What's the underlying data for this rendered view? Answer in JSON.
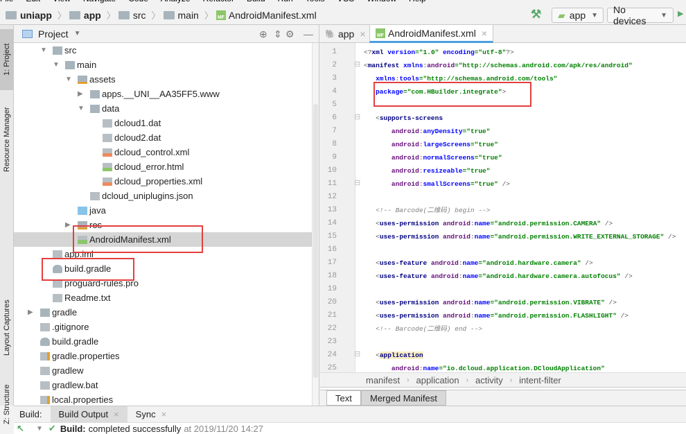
{
  "menubar": [
    "File",
    "Edit",
    "View",
    "Navigate",
    "Code",
    "Analyze",
    "Refactor",
    "Build",
    "Run",
    "Tools",
    "VCS",
    "Window",
    "Help"
  ],
  "breadcrumb": [
    "uniapp",
    "app",
    "src",
    "main",
    "AndroidManifest.xml"
  ],
  "toolbar": {
    "config": "app",
    "device": "No devices"
  },
  "left_strip": {
    "project": "1: Project",
    "resource_manager": "Resource Manager",
    "layout_captures": "Layout Captures",
    "structure": "Z: Structure"
  },
  "project": {
    "title": "Project",
    "tree": [
      {
        "label": "src",
        "level": 1,
        "expand": "open",
        "icon": "folder"
      },
      {
        "label": "main",
        "level": 2,
        "expand": "open",
        "icon": "folder"
      },
      {
        "label": "assets",
        "level": 3,
        "expand": "open",
        "icon": "assets-folder"
      },
      {
        "label": "apps.__UNI__AA35FF5.www",
        "level": 4,
        "expand": "closed",
        "icon": "folder-dot"
      },
      {
        "label": "data",
        "level": 4,
        "expand": "open",
        "icon": "folder-dot"
      },
      {
        "label": "dcloud1.dat",
        "level": 5,
        "icon": "unknown-file"
      },
      {
        "label": "dcloud2.dat",
        "level": 5,
        "icon": "unknown-file"
      },
      {
        "label": "dcloud_control.xml",
        "level": 5,
        "icon": "xml-file"
      },
      {
        "label": "dcloud_error.html",
        "level": 5,
        "icon": "html-file"
      },
      {
        "label": "dcloud_properties.xml",
        "level": 5,
        "icon": "xml-file"
      },
      {
        "label": "dcloud_uniplugins.json",
        "level": 4,
        "icon": "json-file"
      },
      {
        "label": "java",
        "level": 3,
        "icon": "source-folder"
      },
      {
        "label": "res",
        "level": 3,
        "expand": "closed",
        "icon": "res-folder"
      },
      {
        "label": "AndroidManifest.xml",
        "level": 3,
        "icon": "manifest-file",
        "selected": true
      },
      {
        "label": "app.iml",
        "level": 1,
        "icon": "iml-file"
      },
      {
        "label": "build.gradle",
        "level": 1,
        "icon": "gradle-file"
      },
      {
        "label": "proguard-rules.pro",
        "level": 1,
        "icon": "text-file"
      },
      {
        "label": "Readme.txt",
        "level": 1,
        "icon": "text-file"
      },
      {
        "label": "gradle",
        "level": 0,
        "expand": "closed",
        "icon": "folder"
      },
      {
        "label": ".gitignore",
        "level": 0,
        "icon": "text-file"
      },
      {
        "label": "build.gradle",
        "level": 0,
        "icon": "gradle-file"
      },
      {
        "label": "gradle.properties",
        "level": 0,
        "icon": "properties-file"
      },
      {
        "label": "gradlew",
        "level": 0,
        "icon": "text-file"
      },
      {
        "label": "gradlew.bat",
        "level": 0,
        "icon": "text-file"
      },
      {
        "label": "local.properties",
        "level": 0,
        "icon": "properties-file"
      }
    ]
  },
  "editor": {
    "tabs": [
      {
        "label": "app",
        "active": false
      },
      {
        "label": "AndroidManifest.xml",
        "active": true
      }
    ],
    "lines": [
      [
        [
          "<?",
          "punct"
        ],
        [
          "xml ",
          "tag"
        ],
        [
          "version",
          "attr"
        ],
        [
          "=\"1.0\" ",
          "val"
        ],
        [
          "encoding",
          "attr"
        ],
        [
          "=\"utf-8\"",
          "val"
        ],
        [
          "?>",
          "punct"
        ]
      ],
      [
        [
          "<",
          "punct"
        ],
        [
          "manifest ",
          "tag"
        ],
        [
          "xmlns",
          "attr"
        ],
        [
          ":",
          "punct"
        ],
        [
          "android",
          "ns"
        ],
        [
          "=\"http://schemas.android.com/apk/res/android\"",
          "val"
        ]
      ],
      [
        [
          "   xmlns",
          "attr"
        ],
        [
          ":",
          "punct"
        ],
        [
          "tools",
          "attr"
        ],
        [
          "=\"http://schemas.android.com/tools\"",
          "val"
        ]
      ],
      [
        [
          "   package",
          "attr"
        ],
        [
          "=\"com.HBuilder.integrate\"",
          "val"
        ],
        [
          ">",
          "punct"
        ]
      ],
      [],
      [
        [
          "   <",
          "punct"
        ],
        [
          "supports-screens",
          "tag"
        ]
      ],
      [
        [
          "       android",
          "ns"
        ],
        [
          ":",
          "punct"
        ],
        [
          "anyDensity",
          "attr"
        ],
        [
          "=\"true\"",
          "val"
        ]
      ],
      [
        [
          "       android",
          "ns"
        ],
        [
          ":",
          "punct"
        ],
        [
          "largeScreens",
          "attr"
        ],
        [
          "=\"true\"",
          "val"
        ]
      ],
      [
        [
          "       android",
          "ns"
        ],
        [
          ":",
          "punct"
        ],
        [
          "normalScreens",
          "attr"
        ],
        [
          "=\"true\"",
          "val"
        ]
      ],
      [
        [
          "       android",
          "ns"
        ],
        [
          ":",
          "punct"
        ],
        [
          "resizeable",
          "attr"
        ],
        [
          "=\"true\"",
          "val"
        ]
      ],
      [
        [
          "       android",
          "ns"
        ],
        [
          ":",
          "punct"
        ],
        [
          "smallScreens",
          "attr"
        ],
        [
          "=\"true\"",
          "val"
        ],
        [
          " />",
          "punct"
        ]
      ],
      [],
      [
        [
          "   <!-- Barcode(二维码) begin -->",
          "com"
        ]
      ],
      [
        [
          "   <",
          "punct"
        ],
        [
          "uses-permission ",
          "tag"
        ],
        [
          "android",
          "ns"
        ],
        [
          ":",
          "punct"
        ],
        [
          "name",
          "attr"
        ],
        [
          "=\"android.permission.CAMERA\"",
          "val"
        ],
        [
          " />",
          "punct"
        ]
      ],
      [
        [
          "   <",
          "punct"
        ],
        [
          "uses-permission ",
          "tag"
        ],
        [
          "android",
          "ns"
        ],
        [
          ":",
          "punct"
        ],
        [
          "name",
          "attr"
        ],
        [
          "=\"android.permission.WRITE_EXTERNAL_STORAGE\"",
          "val"
        ],
        [
          " />",
          "punct"
        ]
      ],
      [],
      [
        [
          "   <",
          "punct"
        ],
        [
          "uses-feature ",
          "tag"
        ],
        [
          "android",
          "ns"
        ],
        [
          ":",
          "punct"
        ],
        [
          "name",
          "attr"
        ],
        [
          "=\"android.hardware.camera\"",
          "val"
        ],
        [
          " />",
          "punct"
        ]
      ],
      [
        [
          "   <",
          "punct"
        ],
        [
          "uses-feature ",
          "tag"
        ],
        [
          "android",
          "ns"
        ],
        [
          ":",
          "punct"
        ],
        [
          "name",
          "attr"
        ],
        [
          "=\"android.hardware.camera.autofocus\"",
          "val"
        ],
        [
          " />",
          "punct"
        ]
      ],
      [],
      [
        [
          "   <",
          "punct"
        ],
        [
          "uses-permission ",
          "tag"
        ],
        [
          "android",
          "ns"
        ],
        [
          ":",
          "punct"
        ],
        [
          "name",
          "attr"
        ],
        [
          "=\"android.permission.VIBRATE\"",
          "val"
        ],
        [
          " />",
          "punct"
        ]
      ],
      [
        [
          "   <",
          "punct"
        ],
        [
          "uses-permission ",
          "tag"
        ],
        [
          "android",
          "ns"
        ],
        [
          ":",
          "punct"
        ],
        [
          "name",
          "attr"
        ],
        [
          "=\"android.permission.FLASHLIGHT\"",
          "val"
        ],
        [
          " />",
          "punct"
        ]
      ],
      [
        [
          "   <!-- Barcode(二维码) end -->",
          "com"
        ]
      ],
      [],
      [
        [
          "   <",
          "punct"
        ],
        [
          "application",
          "hl"
        ]
      ],
      [
        [
          "       android",
          "ns"
        ],
        [
          ":",
          "punct"
        ],
        [
          "name",
          "attr"
        ],
        [
          "=\"io.dcloud.application.DCloudApplication\"",
          "val"
        ]
      ]
    ],
    "breadcrumb": [
      "manifest",
      "application",
      "activity",
      "intent-filter"
    ],
    "bottom_tabs": [
      {
        "label": "Text",
        "active": true
      },
      {
        "label": "Merged Manifest",
        "active": false
      }
    ]
  },
  "build": {
    "label": "Build:",
    "tabs": [
      "Build Output",
      "Sync"
    ],
    "status_bold": "Build:",
    "status_text": "completed successfully",
    "status_time": "at 2019/11/20 14:27"
  },
  "colors": {
    "highlight_box": "#e53e3e",
    "selection": "#d5d5d5",
    "success": "#59a869"
  }
}
